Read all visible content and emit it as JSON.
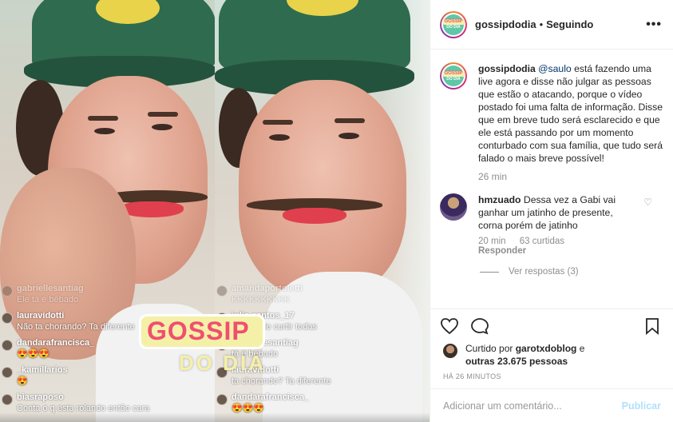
{
  "post": {
    "username": "gossipdodia",
    "separator": "•",
    "follow_status": "Seguindo",
    "more": "•••",
    "logo_top": "GOSSIP",
    "logo_bottom": "DO DIA"
  },
  "caption": {
    "username": "gossipdodia",
    "mention": "@saulo",
    "text": " está fazendo uma live agora e disse não julgar as pessoas que estão o atacando, porque o vídeo postado foi uma falta de informação. Disse que em breve tudo será esclarecido e que ele está passando por um momento conturbado com sua família, que tudo será falado o mais breve possível!",
    "time": "26 min"
  },
  "reply": {
    "username": "hmzuado",
    "text": " Dessa vez a Gabi vai ganhar um jatinho de presente, corna porém de jatinho",
    "time": "20 min",
    "likes": "63 curtidas",
    "reply_label": "Responder",
    "view_replies": "Ver respostas (3)"
  },
  "likes": {
    "prefix": "Curtido por ",
    "user": "garotxdoblog",
    "middle": " e",
    "others": "outras 23.675 pessoas"
  },
  "posted_ago": "HÁ 26 MINUTOS",
  "composer": {
    "placeholder": "Adicionar um comentário...",
    "publish": "Publicar"
  },
  "watermark": {
    "line1": "GOSSIP",
    "line2": "DO DIA"
  },
  "live_left": [
    {
      "user": "gabriellesantiag",
      "text": "Ele tá é bêbado",
      "faded": true
    },
    {
      "user": "lauravidotti",
      "text": "Não ta chorando? Ta diferente",
      "faded": false
    },
    {
      "user": "dandarafrancisca_",
      "text": "😍😍😍",
      "faded": false
    },
    {
      "user": "_kamillarios",
      "text": "😍",
      "faded": false
    },
    {
      "user": "biasraposo",
      "text": "Conta o q esta rolando então cara",
      "faded": false
    }
  ],
  "live_right": [
    {
      "user": "amandaportoletti",
      "text": "KKKKKKKKKK",
      "faded": true
    },
    {
      "user": "julia.santos_17",
      "text": "Depois de curtir todas",
      "faded": false
    },
    {
      "user": "gabriellesantiag",
      "text": "tá é bêbado",
      "faded": false
    },
    {
      "user": "lauravidotti",
      "text": "ta chorando? Ta diferente",
      "faded": false
    },
    {
      "user": "dandarafrancisca_",
      "text": "😍😍😍",
      "faded": false
    }
  ],
  "icons": {
    "heart": "heart-icon",
    "comment": "comment-icon",
    "bookmark": "bookmark-icon",
    "more": "more-options-icon"
  }
}
